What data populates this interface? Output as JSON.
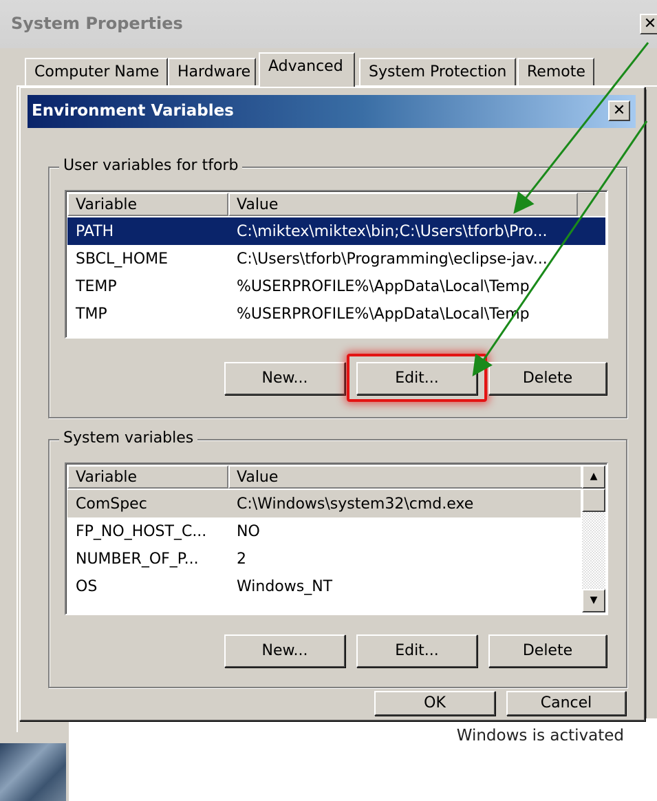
{
  "system_properties": {
    "title": "System Properties",
    "close_glyph": "✕",
    "tabs": [
      {
        "label": "Computer Name"
      },
      {
        "label": "Hardware"
      },
      {
        "label": "Advanced",
        "active": true
      },
      {
        "label": "System Protection"
      },
      {
        "label": "Remote"
      }
    ],
    "activation_text": "Windows is activated"
  },
  "env_dialog": {
    "title": "Environment Variables",
    "close_glyph": "✕",
    "user_group": {
      "label": "User variables for tforb",
      "columns": [
        "Variable",
        "Value"
      ],
      "rows": [
        {
          "variable": "PATH",
          "value": "C:\\miktex\\miktex\\bin;C:\\Users\\tforb\\Pro...",
          "selected": true
        },
        {
          "variable": "SBCL_HOME",
          "value": "C:\\Users\\tforb\\Programming\\eclipse-jav..."
        },
        {
          "variable": "TEMP",
          "value": "%USERPROFILE%\\AppData\\Local\\Temp"
        },
        {
          "variable": "TMP",
          "value": "%USERPROFILE%\\AppData\\Local\\Temp"
        }
      ],
      "buttons": {
        "new": "New...",
        "edit": "Edit...",
        "delete": "Delete"
      }
    },
    "system_group": {
      "label": "System variables",
      "columns": [
        "Variable",
        "Value"
      ],
      "rows": [
        {
          "variable": "ComSpec",
          "value": "C:\\Windows\\system32\\cmd.exe"
        },
        {
          "variable": "FP_NO_HOST_C...",
          "value": "NO"
        },
        {
          "variable": "NUMBER_OF_P...",
          "value": "2"
        },
        {
          "variable": "OS",
          "value": "Windows_NT"
        }
      ],
      "scroll_up_glyph": "▲",
      "scroll_down_glyph": "▼",
      "buttons": {
        "new": "New...",
        "edit": "Edit...",
        "delete": "Delete"
      }
    },
    "ok_label": "OK",
    "cancel_label": "Cancel"
  },
  "colors": {
    "selection": "#0a246a",
    "highlight": "#e31414",
    "annotation_arrow": "#1a8a1a"
  }
}
